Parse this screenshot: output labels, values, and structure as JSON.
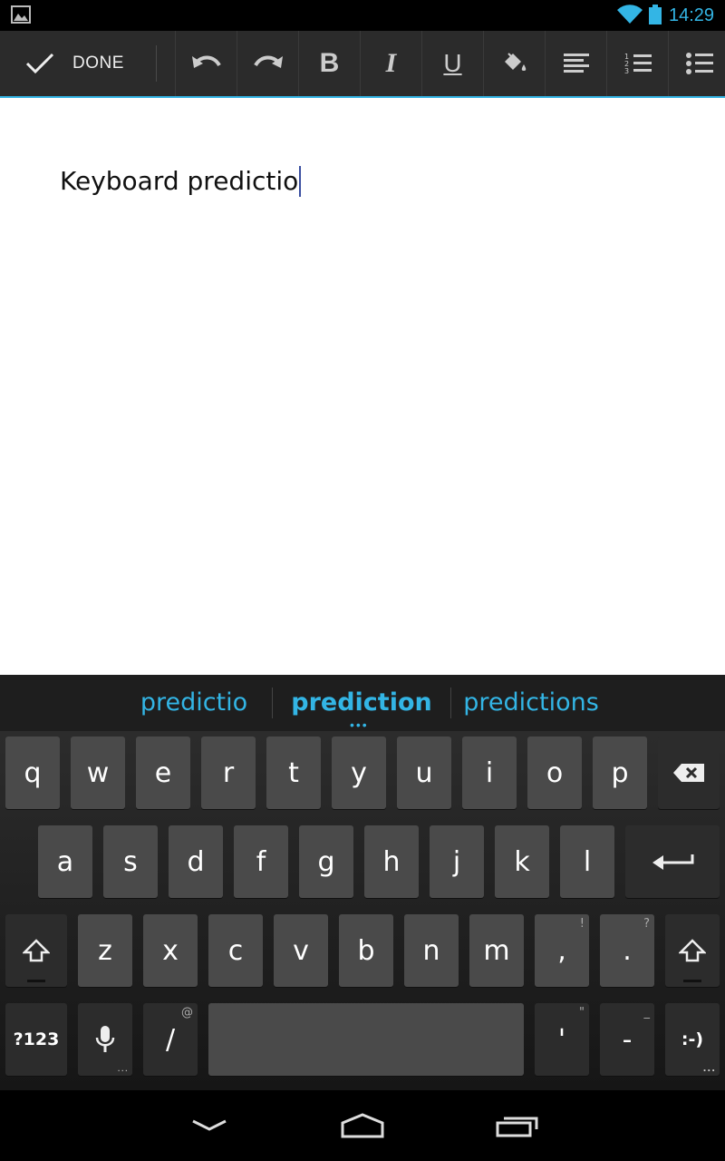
{
  "status_bar": {
    "time": "14:29"
  },
  "action_bar": {
    "done_label": "DONE",
    "tools": [
      "undo",
      "redo",
      "bold",
      "italic",
      "underline",
      "fill-color",
      "align-left",
      "numbered-list",
      "bulleted-list"
    ],
    "bold_glyph": "B",
    "italic_glyph": "I",
    "underline_glyph": "U"
  },
  "document": {
    "text": "Keyboard predictio"
  },
  "suggestions": {
    "left": "predictio",
    "center": "prediction",
    "right": "predictions",
    "more_indicator": "•••"
  },
  "keyboard": {
    "row1": [
      "q",
      "w",
      "e",
      "r",
      "t",
      "y",
      "u",
      "i",
      "o",
      "p"
    ],
    "row2": [
      "a",
      "s",
      "d",
      "f",
      "g",
      "h",
      "j",
      "k",
      "l"
    ],
    "row3": [
      "z",
      "x",
      "c",
      "v",
      "b",
      "n",
      "m",
      ",",
      "."
    ],
    "row3_hints": {
      "comma": "!",
      "period": "?"
    },
    "symbols_label": "?123",
    "slash": "/",
    "slash_hint": "@",
    "apostrophe": "'",
    "apostrophe_hint": "\"",
    "dash": "-",
    "dash_hint": "_",
    "smiley": ":-)",
    "long_press_dots": "..."
  },
  "colors": {
    "accent": "#33b5e5",
    "key": "#4a4a4a",
    "key_dark": "#2c2c2c"
  }
}
